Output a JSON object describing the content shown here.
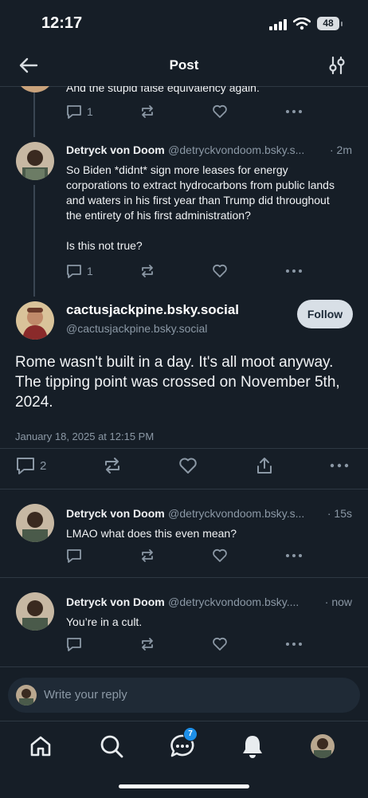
{
  "status_bar": {
    "time": "12:17",
    "battery": "48"
  },
  "header": {
    "title": "Post"
  },
  "partial_post": {
    "text": "And the stupid false equivalency again.",
    "reply_count": "1"
  },
  "thread_post": {
    "author_name": "Detryck von Doom",
    "author_handle": "@detryckvondoom.bsky.s...",
    "time": "· 2m",
    "text": "So Biden *didnt* sign more leases for energy corporations to extract hydrocarbons from public lands and waters in his first year than Trump did throughout the entirety of his first administration?\n\nIs this not true?",
    "reply_count": "1"
  },
  "main_post": {
    "display_name": "cactusjackpine.bsky.social",
    "handle": "@cactusjackpine.bsky.social",
    "follow_label": "Follow",
    "text": "Rome wasn't built in a day. It's all moot anyway. The tipping point was crossed on November 5th, 2024.",
    "timestamp": "January 18, 2025 at 12:15 PM",
    "reply_count": "2"
  },
  "replies": [
    {
      "author_name": "Detryck von Doom",
      "author_handle": "@detryckvondoom.bsky.s...",
      "time": "· 15s",
      "text": "LMAO what does this even mean?"
    },
    {
      "author_name": "Detryck von Doom",
      "author_handle": "@detryckvondoom.bsky....",
      "time": "· now",
      "text": "You’re in a cult."
    }
  ],
  "reply_input": {
    "placeholder": "Write your reply"
  },
  "bottom_nav": {
    "chat_badge": "7"
  },
  "colors": {
    "background": "#161e27",
    "accent": "#1d8fe8",
    "muted": "#8b98a5"
  }
}
